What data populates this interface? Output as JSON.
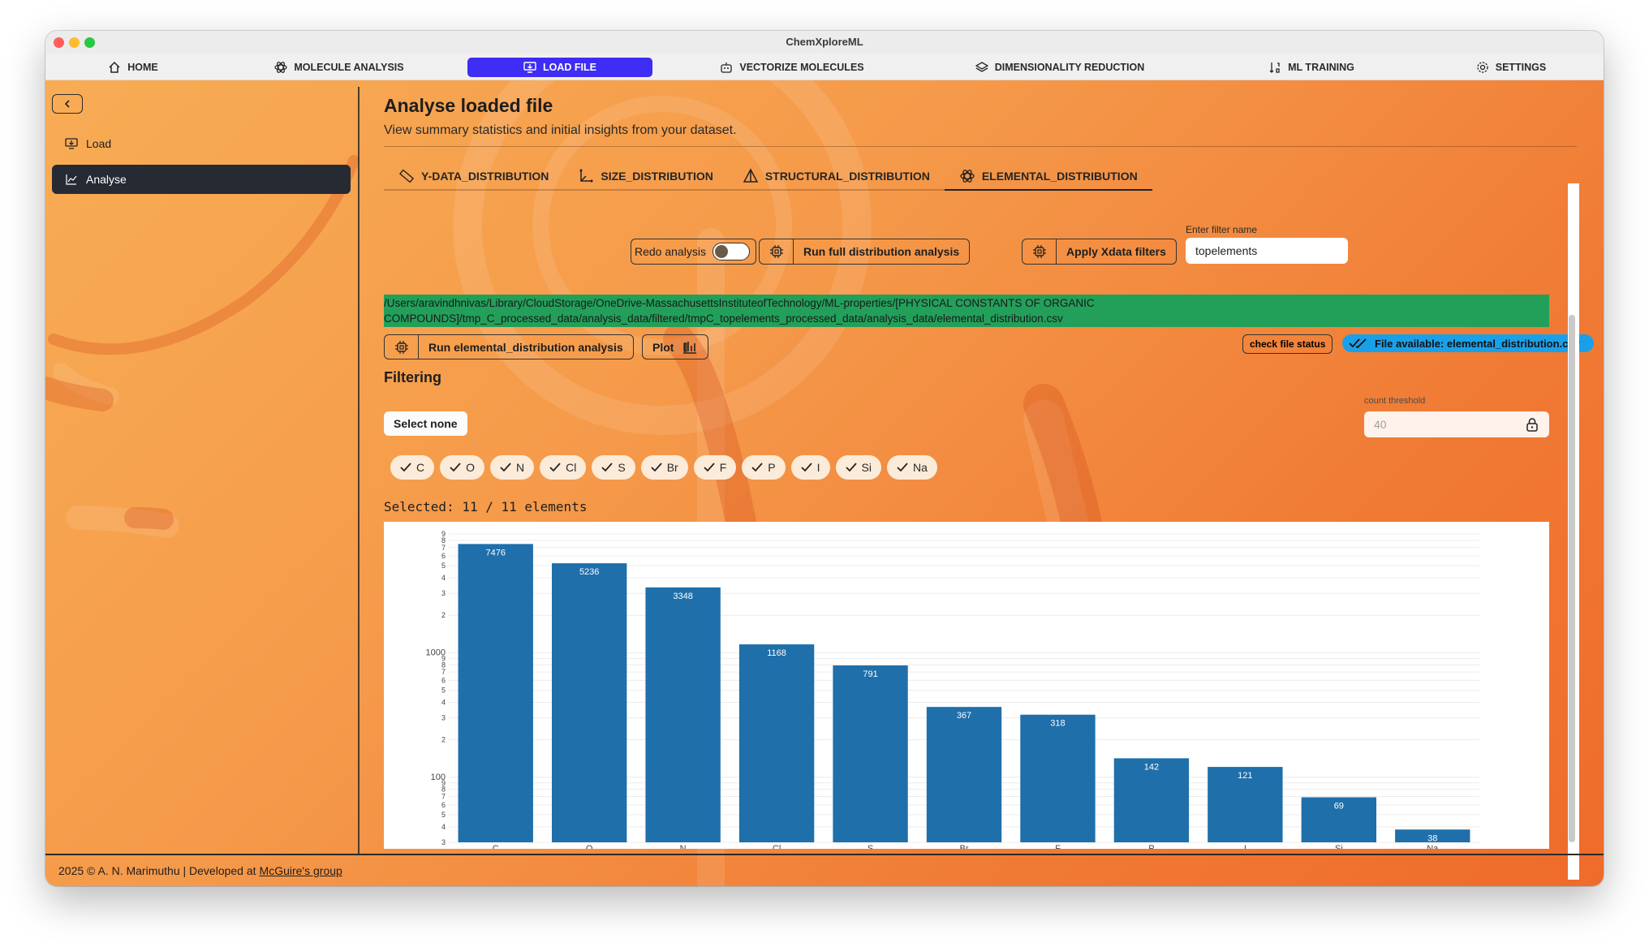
{
  "window": {
    "title": "ChemXploreML"
  },
  "nav": [
    {
      "label": "HOME",
      "icon": "home-icon"
    },
    {
      "label": "MOLECULE ANALYSIS",
      "icon": "atom-icon"
    },
    {
      "label": "LOAD FILE",
      "icon": "monitor-download-icon",
      "active": true
    },
    {
      "label": "VECTORIZE MOLECULES",
      "icon": "robot-icon"
    },
    {
      "label": "DIMENSIONALITY REDUCTION",
      "icon": "layers-icon"
    },
    {
      "label": "ML TRAINING",
      "icon": "sort-icon"
    },
    {
      "label": "SETTINGS",
      "icon": "gear-icon"
    }
  ],
  "sidebar": {
    "items": [
      {
        "label": "Load",
        "icon": "monitor-download-icon"
      },
      {
        "label": "Analyse",
        "icon": "chart-icon",
        "active": true
      }
    ]
  },
  "main": {
    "title": "Analyse loaded file",
    "subtitle": "View summary statistics and initial insights from your dataset.",
    "tabs": [
      {
        "label": "Y-DATA_DISTRIBUTION",
        "icon": "ruler-icon"
      },
      {
        "label": "SIZE_DISTRIBUTION",
        "icon": "axis-icon"
      },
      {
        "label": "STRUCTURAL_DISTRIBUTION",
        "icon": "triangle-icon"
      },
      {
        "label": "ELEMENTAL_DISTRIBUTION",
        "icon": "atom-icon",
        "active": true
      }
    ],
    "controls": {
      "redo_label": "Redo analysis",
      "redo_on": false,
      "run_full_label": "Run full distribution analysis",
      "apply_label": "Apply Xdata filters",
      "filter_name_label": "Enter filter name",
      "filter_name_value": "topelements"
    },
    "path_lines": [
      "/Users/aravindhnivas/Library/CloudStorage/OneDrive-MassachusettsInstituteofTechnology/ML-properties/[PHYSICAL CONSTANTS OF ORGANIC",
      "COMPOUNDS]/tmp_C_processed_data/analysis_data/filtered/tmpC_topelements_processed_data/analysis_data/elemental_distribution.csv"
    ],
    "run_elemental_label": "Run elemental_distribution analysis",
    "plot_label": "Plot",
    "check_status_label": "check file status",
    "file_available_label": "File available: elemental_distribution.csv",
    "filtering": {
      "heading": "Filtering",
      "select_none_label": "Select none",
      "count_threshold_label": "count threshold",
      "count_threshold_placeholder": "40",
      "elements": [
        "C",
        "O",
        "N",
        "Cl",
        "S",
        "Br",
        "F",
        "P",
        "I",
        "Si",
        "Na"
      ],
      "selected_text": "Selected: 11 / 11 elements"
    }
  },
  "chart_data": {
    "type": "bar",
    "categories": [
      "C",
      "O",
      "N",
      "Cl",
      "S",
      "Br",
      "F",
      "P",
      "I",
      "Si",
      "Na"
    ],
    "values": [
      7476,
      5236,
      3348,
      1168,
      791,
      367,
      318,
      142,
      121,
      69,
      38
    ],
    "value_labels": [
      "7476",
      "5236",
      "3348",
      "1168",
      "791",
      "367",
      "318",
      "142",
      "121",
      "69",
      "38"
    ],
    "yscale": "log",
    "ylim": [
      30,
      10000
    ],
    "y_tick_labels": [
      "3",
      "4",
      "5",
      "6",
      "7",
      "8",
      "9",
      "100",
      "2",
      "3",
      "4",
      "5",
      "6",
      "7",
      "8",
      "9",
      "1000",
      "2",
      "3",
      "4",
      "5",
      "6",
      "7",
      "8",
      "9"
    ],
    "bar_color": "#1f6fab",
    "grid": true
  },
  "footer": {
    "text": "2025 © A. N. Marimuthu | Developed at",
    "link": "McGuire's group"
  },
  "colors": {
    "active_nav": "#3f2cf5",
    "path_bg": "#22a05a",
    "file_badge": "#1aa0e8",
    "sidebar_active": "#262a33"
  }
}
